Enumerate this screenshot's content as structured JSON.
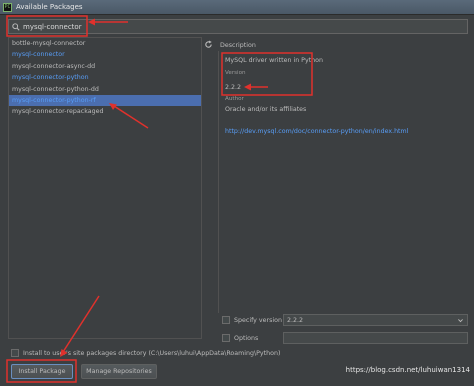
{
  "window": {
    "title": "Available Packages",
    "icon": "pycharm-icon"
  },
  "search": {
    "value": "mysql-connector",
    "icon": "search-icon"
  },
  "packages": [
    {
      "name": "bottle-mysql-connector",
      "state": "normal"
    },
    {
      "name": "mysql-connector",
      "state": "installed"
    },
    {
      "name": "mysql-connector-async-dd",
      "state": "normal"
    },
    {
      "name": "mysql-connector-python",
      "state": "installed"
    },
    {
      "name": "mysql-connector-python-dd",
      "state": "normal"
    },
    {
      "name": "mysql-connector-python-rf",
      "state": "selected"
    },
    {
      "name": "mysql-connector-repackaged",
      "state": "normal"
    }
  ],
  "refresh_icon": "refresh-icon",
  "description": {
    "header": "Description",
    "summary": "MySQL driver written in Python",
    "version_label": "Version",
    "version": "2.2.2",
    "author_label": "Author",
    "author": "Oracle and/or its affiliates",
    "url": "http://dev.mysql.com/doc/connector-python/en/index.html"
  },
  "options": {
    "specify_version_label": "Specify version",
    "specify_version_value": "2.2.2",
    "options_label": "Options",
    "site_packages_label": "Install to user's site packages directory (C:\\Users\\luhui\\AppData\\Roaming\\Python)"
  },
  "buttons": {
    "install": "Install Package",
    "manage": "Manage Repositories"
  },
  "watermark": "https://blog.csdn.net/luhuiwan1314",
  "colors": {
    "background": "#3c3f41",
    "selection": "#4b6eaf",
    "link": "#589df6",
    "annotation": "#e0312c"
  }
}
